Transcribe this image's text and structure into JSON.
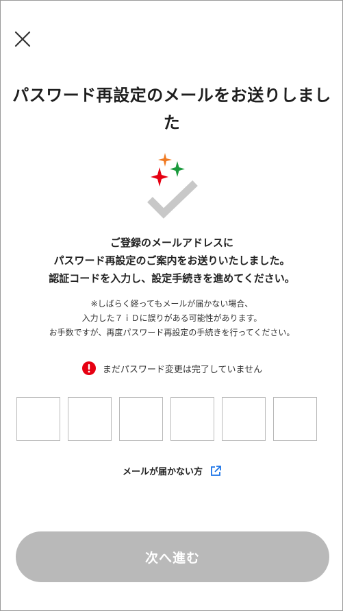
{
  "header": {
    "close_icon": "close-icon"
  },
  "main": {
    "title_line1": "パスワード再設定のメールをお送りしまし",
    "title_line2": "た",
    "hero_icon": "sparkle-check-icon",
    "lead": [
      "ご登録のメールアドレスに",
      "パスワード再設定のご案内をお送りいたしました。",
      "認証コードを入力し、設定手続きを進めてください。"
    ],
    "note": [
      "※しばらく経ってもメールが届かない場合、",
      "入力した７ｉＤに誤りがある可能性があります。",
      "お手数ですが、再度パスワード再設定の手続きを行ってください。"
    ],
    "warning_text": "まだパスワード変更は完了していません",
    "code_inputs": [
      "",
      "",
      "",
      "",
      "",
      ""
    ],
    "no_mail_link": "メールが届かない方",
    "next_button": "次へ進む"
  },
  "colors": {
    "warning_red": "#e60012",
    "link_blue": "#1a73e8",
    "disabled_button": "#b9b9b9",
    "sparkle_orange": "#f07a22",
    "sparkle_red": "#e60012",
    "sparkle_green": "#1a9a3c"
  }
}
